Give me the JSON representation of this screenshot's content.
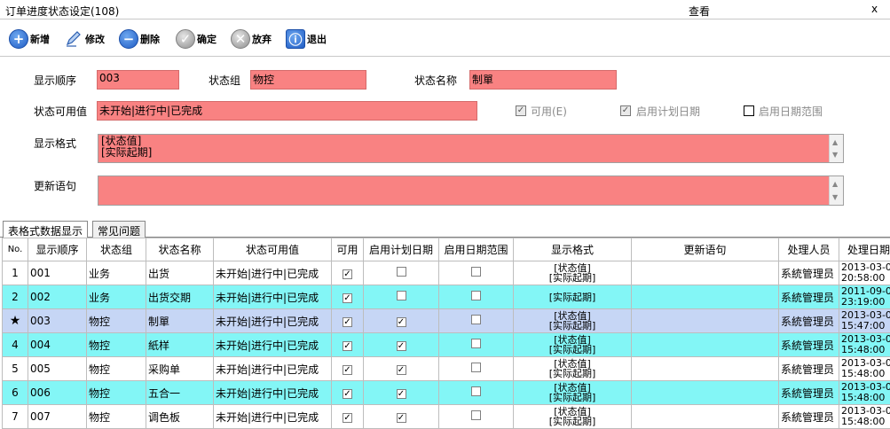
{
  "window": {
    "title": "订单进度状态设定(108)",
    "view": "查看",
    "close": "x"
  },
  "toolbar": {
    "new": "新增",
    "edit": "修改",
    "delete": "删除",
    "confirm": "确定",
    "discard": "放弃",
    "exit": "退出"
  },
  "form": {
    "order_label": "显示顺序",
    "order_value": "003",
    "group_label": "状态组",
    "group_value": "物控",
    "name_label": "状态名称",
    "name_value": "制單",
    "values_label": "状态可用值",
    "values_value": "未开始|进行中|已完成",
    "enabled_label": "可用(E)",
    "plan_date_label": "启用计划日期",
    "date_range_label": "启用日期范围",
    "format_label": "显示格式",
    "format_line1": "[状态值]",
    "format_line2": "[实际起期]",
    "update_label": "更新语句"
  },
  "tabs": {
    "grid": "表格式数据显示",
    "faq": "常见问题"
  },
  "table": {
    "headers": [
      "No.",
      "显示顺序",
      "状态组",
      "状态名称",
      "状态可用值",
      "可用",
      "启用计划日期",
      "启用日期范围",
      "显示格式",
      "更新语句",
      "处理人员",
      "处理日期"
    ],
    "rows": [
      {
        "no": "1",
        "order": "001",
        "group": "业务",
        "name": "出货",
        "values": "未开始|进行中|已完成",
        "enabled": true,
        "plan": false,
        "range": false,
        "fmt1": "[状态值]",
        "fmt2": "[实际起期]",
        "update": "",
        "user": "系統管理员",
        "date1": "2013-03-0",
        "date2": "20:58:00"
      },
      {
        "no": "2",
        "order": "002",
        "group": "业务",
        "name": "出货交期",
        "values": "未开始|进行中|已完成",
        "enabled": true,
        "plan": false,
        "range": false,
        "fmt1": "",
        "fmt2": "[实际起期]",
        "update": "",
        "user": "系統管理员",
        "date1": "2011-09-0",
        "date2": "23:19:00"
      },
      {
        "no": "★",
        "order": "003",
        "group": "物控",
        "name": "制單",
        "values": "未开始|进行中|已完成",
        "enabled": true,
        "plan": true,
        "range": false,
        "fmt1": "[状态值]",
        "fmt2": "[实际起期]",
        "update": "",
        "user": "系統管理员",
        "date1": "2013-03-0",
        "date2": "15:47:00"
      },
      {
        "no": "4",
        "order": "004",
        "group": "物控",
        "name": "紙样",
        "values": "未开始|进行中|已完成",
        "enabled": true,
        "plan": true,
        "range": false,
        "fmt1": "[状态值]",
        "fmt2": "[实际起期]",
        "update": "",
        "user": "系統管理员",
        "date1": "2013-03-0",
        "date2": "15:48:00"
      },
      {
        "no": "5",
        "order": "005",
        "group": "物控",
        "name": "采购单",
        "values": "未开始|进行中|已完成",
        "enabled": true,
        "plan": true,
        "range": false,
        "fmt1": "[状态值]",
        "fmt2": "[实际起期]",
        "update": "",
        "user": "系統管理员",
        "date1": "2013-03-0",
        "date2": "15:48:00"
      },
      {
        "no": "6",
        "order": "006",
        "group": "物控",
        "name": "五合一",
        "values": "未开始|进行中|已完成",
        "enabled": true,
        "plan": true,
        "range": false,
        "fmt1": "[状态值]",
        "fmt2": "[实际起期]",
        "update": "",
        "user": "系統管理员",
        "date1": "2013-03-0",
        "date2": "15:48:00"
      },
      {
        "no": "7",
        "order": "007",
        "group": "物控",
        "name": "调色板",
        "values": "未开始|进行中|已完成",
        "enabled": true,
        "plan": true,
        "range": false,
        "fmt1": "[状态值]",
        "fmt2": "[实际起期]",
        "update": "",
        "user": "系統管理员",
        "date1": "2013-03-0",
        "date2": "15:48:00"
      }
    ]
  },
  "colors": {
    "field_bg": "#f98282",
    "row_cyan": "#83f6f6",
    "row_selected": "#c6d6f5",
    "icon_blue": "#1f5cc4"
  },
  "icons": {
    "new": "plus-circle-icon",
    "edit": "pencil-icon",
    "delete": "minus-circle-icon",
    "confirm": "check-circle-icon",
    "discard": "x-circle-icon",
    "exit": "info-icon",
    "current_row": "star-icon"
  }
}
